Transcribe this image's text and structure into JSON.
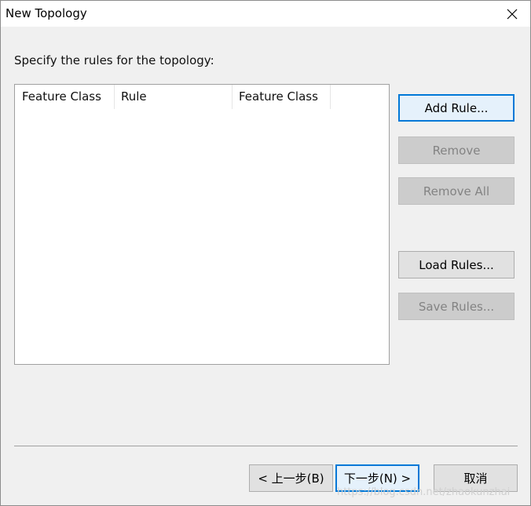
{
  "window": {
    "title": "New Topology"
  },
  "instruction": "Specify the rules for the topology:",
  "rules_list": {
    "columns": [
      "Feature Class",
      "Rule",
      "Feature Class"
    ],
    "rows": []
  },
  "side_buttons": {
    "add_rule": "Add Rule...",
    "remove": "Remove",
    "remove_all": "Remove All",
    "load_rules": "Load Rules...",
    "save_rules": "Save Rules..."
  },
  "footer": {
    "back": "< 上一步(B)",
    "next": "下一步(N) >",
    "cancel": "取消"
  },
  "watermark": "https://blog.csdn.net/zhaokunzhai"
}
